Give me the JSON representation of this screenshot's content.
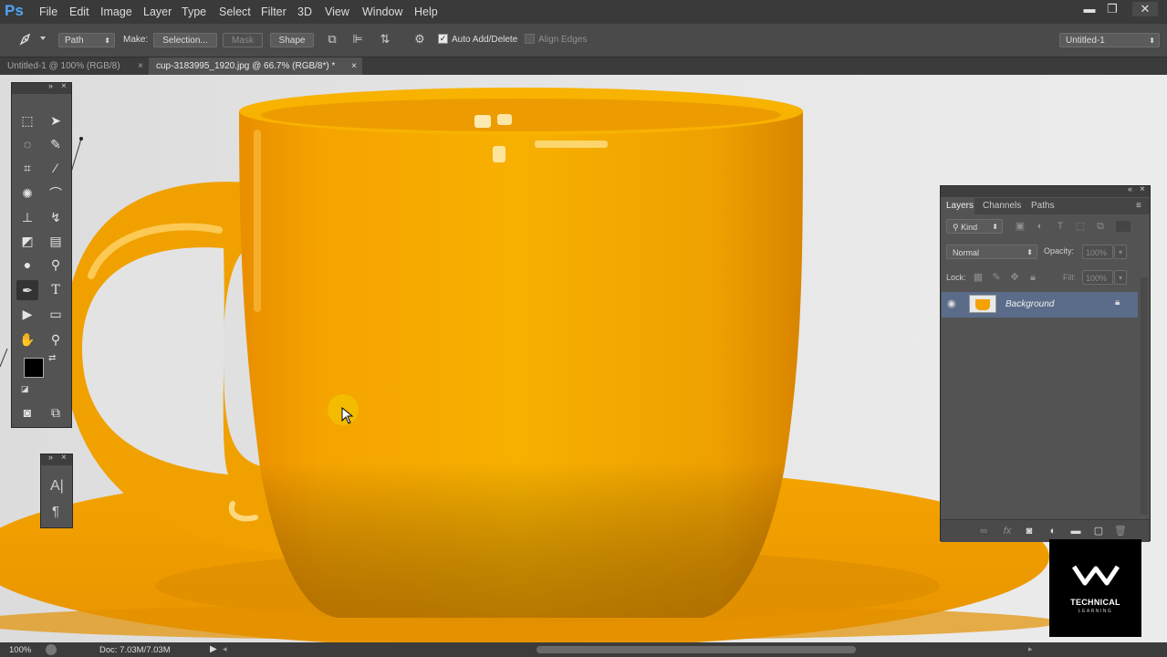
{
  "app": {
    "logo": "Ps"
  },
  "menu": [
    "File",
    "Edit",
    "Image",
    "Layer",
    "Type",
    "Select",
    "Filter",
    "3D",
    "View",
    "Window",
    "Help"
  ],
  "window_controls": {
    "minimize": "▬",
    "restore": "❐",
    "close": "✕"
  },
  "options": {
    "tool_icon": "pen-tool-icon",
    "mode_value": "Path",
    "make_label": "Make:",
    "selection_button": "Selection...",
    "mask_button": "Mask",
    "shape_button": "Shape",
    "auto_add_delete": "Auto Add/Delete",
    "auto_add_delete_checked": true,
    "align_edges": "Align Edges",
    "workspace": "Untitled-1"
  },
  "tabs": [
    {
      "label": "Untitled-1 @ 100% (RGB/8)",
      "active": false
    },
    {
      "label": "cup-3183995_1920.jpg @ 66.7% (RGB/8*) *",
      "active": true
    }
  ],
  "tab_close": "×",
  "colors": {
    "foreground": "#000000",
    "background": "#0a2fd6",
    "accent": "#f0a300",
    "selected_layer": "#5a6c89"
  },
  "layers_panel": {
    "tabs": [
      "Layers",
      "Channels",
      "Paths"
    ],
    "filter_kind": "Kind",
    "blend_mode": "Normal",
    "opacity_label": "Opacity:",
    "opacity_value": "100%",
    "lock_label": "Lock:",
    "fill_label": "Fill:",
    "fill_value": "100%",
    "layers": [
      {
        "name": "Background",
        "locked": true,
        "visible": true
      }
    ],
    "footer_icons": [
      "link-icon",
      "fx-icon",
      "mask-icon",
      "adjustment-icon",
      "folder-icon",
      "new-layer-icon",
      "trash-icon"
    ]
  },
  "status": {
    "zoom": "100%",
    "doc": "Doc: 7.03M/7.03M"
  },
  "watermark": {
    "line1": "TECHNICAL",
    "line2": "LEARNING"
  }
}
